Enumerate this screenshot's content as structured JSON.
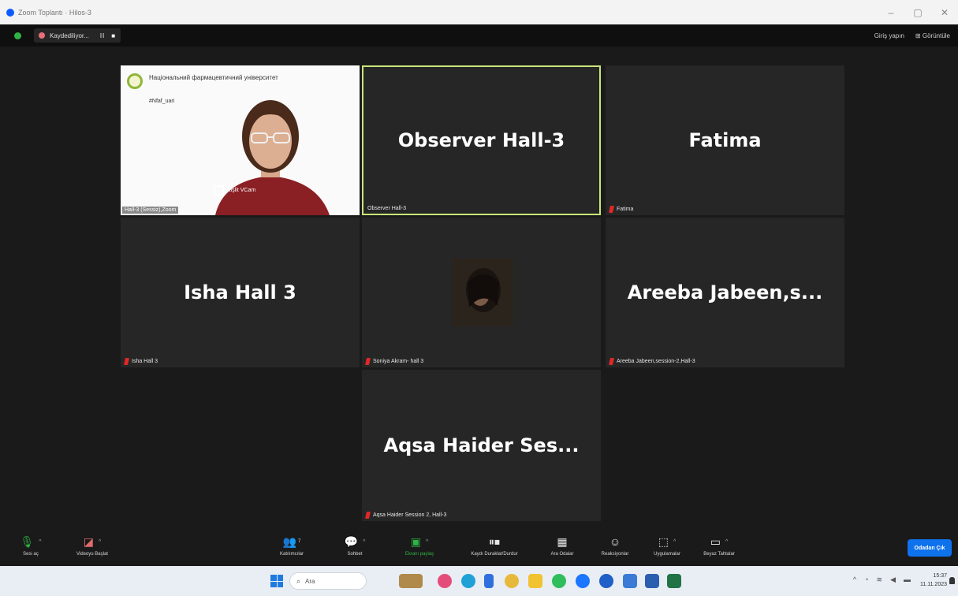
{
  "window": {
    "title": "Zoom Toplantı · Hilos-3",
    "controls": {
      "minimize": "–",
      "maximize": "▢",
      "close": "✕"
    }
  },
  "meeting_bar": {
    "recording_label": "Kaydediliyor...",
    "pause": "II",
    "stop": "■",
    "right_items": [
      "Giriş yapın",
      "Görüntüle"
    ]
  },
  "tiles": [
    {
      "id": "hall3",
      "display": "",
      "name": "Hall-3 (Sessiz),Zoom",
      "video": true,
      "muted": false,
      "overlay": {
        "university": "Національний фармацевтичний університет",
        "hashtag": "#Nfaf_uari",
        "cam": "Kişlit VCam"
      }
    },
    {
      "id": "observer",
      "display": "Observer Hall-3",
      "name": "Observer Hall-3",
      "video": false,
      "muted": false,
      "active": true
    },
    {
      "id": "fatima",
      "display": "Fatima",
      "name": "Fatima",
      "video": false,
      "muted": true
    },
    {
      "id": "isha",
      "display": "Isha Hall 3",
      "name": "Isha Hall 3",
      "video": false,
      "muted": true
    },
    {
      "id": "soniya",
      "display": "",
      "name": "Soniya Akram- hall 3",
      "video": false,
      "muted": true,
      "avatar": true
    },
    {
      "id": "areeba",
      "display": "Areeba  Jabeen,s...",
      "name": "Areeba Jabeen,session-2,Hall-3",
      "video": false,
      "muted": true
    },
    {
      "id": "aqsa",
      "display": "Aqsa Haider Ses...",
      "name": "Aqsa Haider Session 2, Hall-3",
      "video": false,
      "muted": true
    }
  ],
  "toolbar": {
    "audio": {
      "label": "Sesi aç",
      "icon": "microphone-icon"
    },
    "video": {
      "label": "Videoyu Başlat",
      "icon": "video-off-icon"
    },
    "participants": {
      "label": "Katılımcılar",
      "count": "7",
      "icon": "participants-icon"
    },
    "chat": {
      "label": "Sohbet",
      "icon": "chat-icon"
    },
    "share": {
      "label": "Ekranı paylaş",
      "icon": "share-screen-icon",
      "color": "#2fb344"
    },
    "record": {
      "label": "Kaydı Duraklat/Durdur",
      "icon": "record-icon"
    },
    "breakout": {
      "label": "Ara Odalar",
      "icon": "breakout-rooms-icon"
    },
    "reactions": {
      "label": "Reaksiyonlar",
      "icon": "reactions-icon"
    },
    "apps": {
      "label": "Uygulamalar",
      "icon": "apps-icon"
    },
    "whiteboard": {
      "label": "Beyaz Tahtalar",
      "icon": "whiteboard-icon"
    },
    "leave": {
      "label": "Odadan Çık",
      "color": "#0e72ed"
    }
  },
  "taskbar": {
    "search_placeholder": "Ara",
    "time": "15:37",
    "date": "11.11.2023"
  }
}
